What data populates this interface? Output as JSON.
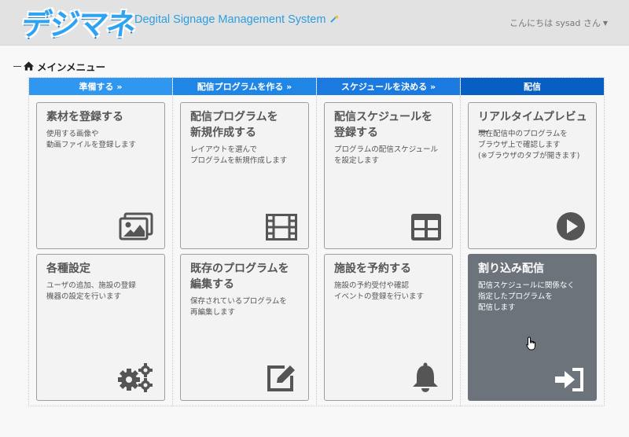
{
  "header": {
    "logo_text": "デジマネ",
    "subtitle": "Degital Signage Management System",
    "wand_icon": "magic-wand-icon",
    "user_greeting": "こんにちは sysad さん",
    "caret_icon": "caret-down-icon"
  },
  "main_menu": {
    "title": "メインメニュー",
    "icon": "home-icon"
  },
  "columns": [
    {
      "label": "準備する »",
      "color": "#2f97ef"
    },
    {
      "label": "配信プログラムを作る »",
      "color": "#1f86e6"
    },
    {
      "label": "スケジュールを決める »",
      "color": "#1a7ae0"
    },
    {
      "label": "配信",
      "color": "#075fc4"
    }
  ],
  "cards": [
    {
      "title_lines": [
        "素材を登録する"
      ],
      "desc_lines": [
        "使用する画像や",
        "動画ファイルを登録します"
      ],
      "icon": "image-icon"
    },
    {
      "title_lines": [
        "配信プログラムを",
        "新規作成する"
      ],
      "desc_lines": [
        "レイアウトを選んで",
        "プログラムを新規作成します"
      ],
      "icon": "film-icon"
    },
    {
      "title_lines": [
        "配信スケジュールを",
        "登録する"
      ],
      "desc_lines": [
        "プログラムの配信スケジュール",
        "を設定します"
      ],
      "icon": "table-grid-icon"
    },
    {
      "title_lines": [
        "リアルタイムプレビュー"
      ],
      "desc_lines": [
        "現在配信中のプログラムを",
        "ブラウザ上で確認します",
        "(※ブラウザのタブが開きます)"
      ],
      "icon": "play-circle-icon"
    },
    {
      "title_lines": [
        "各種設定"
      ],
      "desc_lines": [
        "ユーザの追加、施設の登録",
        "機器の設定を行います"
      ],
      "icon": "gears-icon"
    },
    {
      "title_lines": [
        "既存のプログラムを",
        "編集する"
      ],
      "desc_lines": [
        "保存されているプログラムを",
        "再編集します"
      ],
      "icon": "edit-icon"
    },
    {
      "title_lines": [
        "施設を予約する"
      ],
      "desc_lines": [
        "施設の予約受付や確認",
        "イベントの登録を行います"
      ],
      "icon": "bell-icon"
    },
    {
      "title_lines": [
        "割り込み配信"
      ],
      "desc_lines": [
        "配信スケジュールに関係なく",
        "指定したプログラムを",
        "配信します"
      ],
      "icon": "sign-in-icon"
    }
  ],
  "colors": {
    "header_bg": "#e2e2e2",
    "brand_blue": "#2c9ee0",
    "card_bg": "#f3f3f3",
    "card_active_bg": "#6c737b",
    "icon_gray": "#555555"
  }
}
